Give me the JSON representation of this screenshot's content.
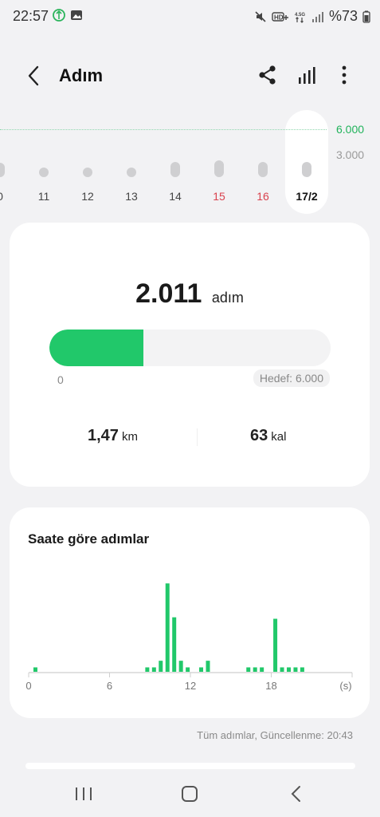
{
  "status_bar": {
    "time": "22:57",
    "icons_left": [
      "status-app-icon",
      "gallery-icon"
    ],
    "icons_right": [
      "mute-icon",
      "hd-plus-icon",
      "network-4-5g-icon",
      "signal-icon"
    ],
    "battery": "%73"
  },
  "header": {
    "title": "Adım",
    "actions": [
      "share-icon",
      "chart-bars-icon",
      "more-vertical-icon"
    ]
  },
  "day_strip": {
    "goal_label": "6.000",
    "mid_label": "3.000",
    "days": [
      {
        "label": "0",
        "weekend": false,
        "selected": false,
        "level": 0.3
      },
      {
        "label": "11",
        "weekend": false,
        "selected": false,
        "level": 0.0
      },
      {
        "label": "12",
        "weekend": false,
        "selected": false,
        "level": 0.0
      },
      {
        "label": "13",
        "weekend": false,
        "selected": false,
        "level": 0.0
      },
      {
        "label": "14",
        "weekend": false,
        "selected": false,
        "level": 0.35
      },
      {
        "label": "15",
        "weekend": true,
        "selected": false,
        "level": 0.45
      },
      {
        "label": "16",
        "weekend": true,
        "selected": false,
        "level": 0.33
      },
      {
        "label": "17/2",
        "weekend": false,
        "selected": true,
        "level": 0.34
      }
    ]
  },
  "steps_summary": {
    "total": "2.011",
    "unit": "adım",
    "progress_fraction": 0.335,
    "progress_min": "0",
    "goal_label": "Hedef: 6.000",
    "distance_value": "1,47",
    "distance_unit": "km",
    "calories_value": "63",
    "calories_unit": "kal"
  },
  "hourly": {
    "title": "Saate göre adımlar"
  },
  "chart_data": {
    "type": "bar",
    "title": "Saate göre adımlar",
    "xlabel": "(s)",
    "x_ticks": [
      "0",
      "6",
      "12",
      "18"
    ],
    "xlim": [
      0,
      24
    ],
    "ylim": [
      0,
      650
    ],
    "color": "#21c86a",
    "points": [
      {
        "x": 0.5,
        "y": 30
      },
      {
        "x": 8.8,
        "y": 30
      },
      {
        "x": 9.3,
        "y": 30
      },
      {
        "x": 9.8,
        "y": 75
      },
      {
        "x": 10.3,
        "y": 600
      },
      {
        "x": 10.8,
        "y": 370
      },
      {
        "x": 11.3,
        "y": 75
      },
      {
        "x": 11.8,
        "y": 30
      },
      {
        "x": 12.8,
        "y": 30
      },
      {
        "x": 13.3,
        "y": 75
      },
      {
        "x": 16.3,
        "y": 30
      },
      {
        "x": 16.8,
        "y": 30
      },
      {
        "x": 17.3,
        "y": 30
      },
      {
        "x": 18.3,
        "y": 360
      },
      {
        "x": 18.8,
        "y": 30
      },
      {
        "x": 19.3,
        "y": 30
      },
      {
        "x": 19.8,
        "y": 30
      },
      {
        "x": 20.3,
        "y": 30
      }
    ]
  },
  "footer": {
    "note": "Tüm adımlar, Güncellenme: 20:43"
  },
  "nav_bar": {
    "buttons": [
      "recent-apps-icon",
      "home-icon",
      "back-nav-icon"
    ]
  },
  "colors": {
    "accent": "#21c86a",
    "weekend": "#d9434e",
    "background": "#f2f2f4"
  }
}
